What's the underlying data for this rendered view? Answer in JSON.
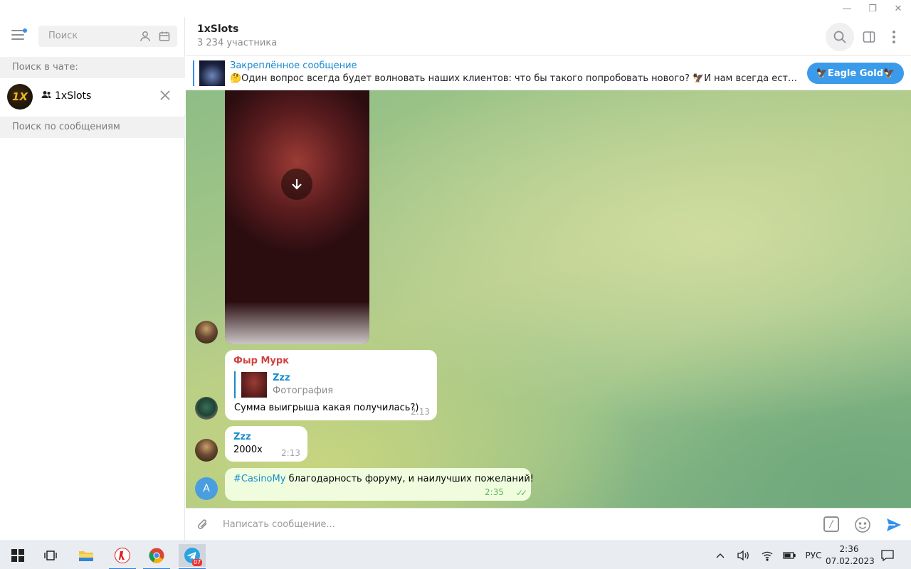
{
  "window": {
    "minimize": "—",
    "restore": "❐",
    "close": "✕"
  },
  "sidebar": {
    "search_placeholder": "Поиск",
    "search_in_chat_label": "Поиск в чате:",
    "chat_name": "1xSlots",
    "chat_avatar_text": "1X",
    "search_messages_label": "Поиск по сообщениям"
  },
  "header": {
    "title": "1xSlots",
    "subtitle": "3 234 участника"
  },
  "pinned": {
    "title": "Закреплённое сообщение",
    "text": "🤔Один вопрос всегда будет волновать наших клиентов: что бы такого попробовать нового? 🦅И нам всегда есть, что на э...",
    "button_label": "🦅Eagle Gold🦅"
  },
  "messages": [
    {
      "type": "video",
      "download_icon": "↓"
    },
    {
      "sender": "Фыр Мурк",
      "sender_color": "#d04242",
      "reply_name": "Zzz",
      "reply_type": "Фотография",
      "text": "Сумма выигрыша какая получилась?)",
      "time": "2:13"
    },
    {
      "sender": "Zzz",
      "sender_color": "#168acd",
      "text": "2000х",
      "time": "2:13"
    },
    {
      "hashtag": "#CasinoMy",
      "text": " благодарность форуму, и наилучших пожеланий!",
      "time": "2:35",
      "avatar_letter": "A",
      "status": "✓✓"
    }
  ],
  "composer": {
    "placeholder": "Написать сообщение...",
    "commands_label": "/"
  },
  "taskbar": {
    "telegram_badge": "07",
    "language": "РУС",
    "time": "2:36",
    "date": "07.02.2023"
  },
  "colors": {
    "accent": "#3390ec",
    "link": "#168acd",
    "own_bubble": "#effdde"
  }
}
